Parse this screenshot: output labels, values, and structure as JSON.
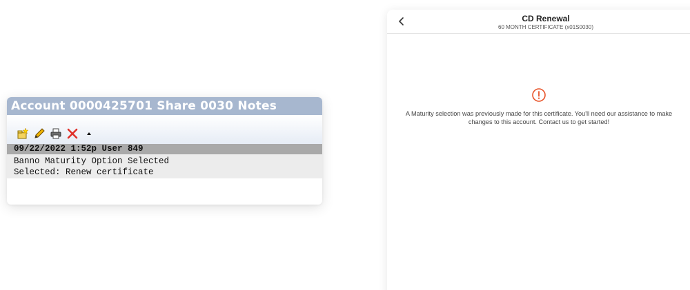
{
  "notes": {
    "title": "Account 0000425701 Share 0030 Notes",
    "toolbar": {
      "icons": [
        "new-note-icon",
        "edit-pencil-icon",
        "print-icon",
        "delete-x-icon",
        "collapse-arrow-icon"
      ]
    },
    "entry": {
      "meta": "09/22/2022 1:52p User 849",
      "lines": [
        "Banno Maturity Option Selected",
        "Selected: Renew certificate"
      ]
    }
  },
  "renewal": {
    "title": "CD Renewal",
    "subtitle": "60 MONTH CERTIFICATE (x01S0030)",
    "message": "A Maturity selection was previously made for this certificate. You'll need our assistance to make changes to this account. Contact us to get started!",
    "colors": {
      "alert": "#e8542a"
    }
  },
  "colors": {
    "notes_header": "#a7b7cf",
    "meta_row": "#a9a9a9",
    "body_row": "#ececec"
  }
}
